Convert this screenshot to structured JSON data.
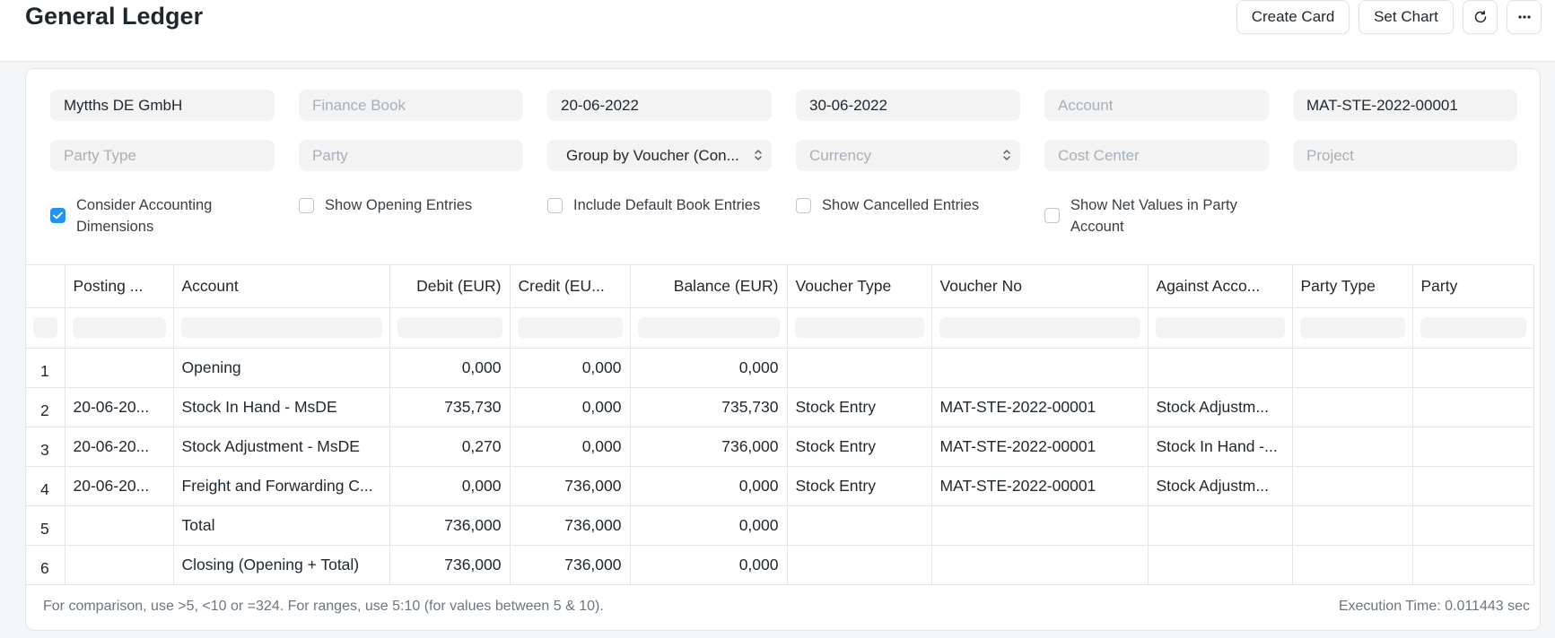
{
  "page": {
    "title": "General Ledger"
  },
  "toolbar": {
    "create_card": "Create Card",
    "set_chart": "Set Chart"
  },
  "filters": {
    "company": "Mytths DE GmbH",
    "finance_book_ph": "Finance Book",
    "from_date": "20-06-2022",
    "to_date": "30-06-2022",
    "account_ph": "Account",
    "voucher_no": "MAT-STE-2022-00001",
    "party_type_ph": "Party Type",
    "party_ph": "Party",
    "group_by": "Group by Voucher (Con...",
    "currency_ph": "Currency",
    "cost_center_ph": "Cost Center",
    "project_ph": "Project"
  },
  "checkboxes": {
    "consider_dims_1": "Consider Accounting",
    "consider_dims_2": "Dimensions",
    "show_opening": "Show Opening Entries",
    "include_default": "Include Default Book Entries",
    "show_cancelled": "Show Cancelled Entries",
    "show_net_1": "Show Net Values in Party",
    "show_net_2": "Account"
  },
  "table": {
    "headers": {
      "posting": "Posting ...",
      "account": "Account",
      "debit": "Debit (EUR)",
      "credit": "Credit (EU...",
      "balance": "Balance (EUR)",
      "voucher_type": "Voucher Type",
      "voucher_no": "Voucher No",
      "against": "Against Acco...",
      "party_type": "Party Type",
      "party": "Party"
    },
    "rows": [
      {
        "num": "1",
        "posting": "",
        "account": "Opening",
        "debit": "0,000",
        "credit": "0,000",
        "balance": "0,000",
        "voucher_type": "",
        "voucher_no": "",
        "against": ""
      },
      {
        "num": "2",
        "posting": "20-06-20...",
        "account": "Stock In Hand - MsDE",
        "debit": "735,730",
        "credit": "0,000",
        "balance": "735,730",
        "voucher_type": "Stock Entry",
        "voucher_no": "MAT-STE-2022-00001",
        "against": "Stock Adjustm..."
      },
      {
        "num": "3",
        "posting": "20-06-20...",
        "account": "Stock Adjustment - MsDE",
        "debit": "0,270",
        "credit": "0,000",
        "balance": "736,000",
        "voucher_type": "Stock Entry",
        "voucher_no": "MAT-STE-2022-00001",
        "against": "Stock In Hand -..."
      },
      {
        "num": "4",
        "posting": "20-06-20...",
        "account": "Freight and Forwarding C...",
        "debit": "0,000",
        "credit": "736,000",
        "balance": "0,000",
        "voucher_type": "Stock Entry",
        "voucher_no": "MAT-STE-2022-00001",
        "against": "Stock Adjustm..."
      },
      {
        "num": "5",
        "posting": "",
        "account": "Total",
        "debit": "736,000",
        "credit": "736,000",
        "balance": "0,000",
        "voucher_type": "",
        "voucher_no": "",
        "against": ""
      },
      {
        "num": "6",
        "posting": "",
        "account": "Closing (Opening + Total)",
        "debit": "736,000",
        "credit": "736,000",
        "balance": "0,000",
        "voucher_type": "",
        "voucher_no": "",
        "against": ""
      }
    ]
  },
  "footer": {
    "hint": "For comparison, use >5, <10 or =324. For ranges, use 5:10 (for values between 5 & 10).",
    "execution_time": "Execution Time: 0.011443 sec"
  },
  "colors": {
    "accent": "#2490ef",
    "field_bg": "#f3f3f3",
    "border": "#e2e6e9"
  },
  "icons": {
    "refresh": "refresh-icon",
    "more": "more-icon",
    "select": "select-arrows-icon",
    "check": "check-icon"
  }
}
